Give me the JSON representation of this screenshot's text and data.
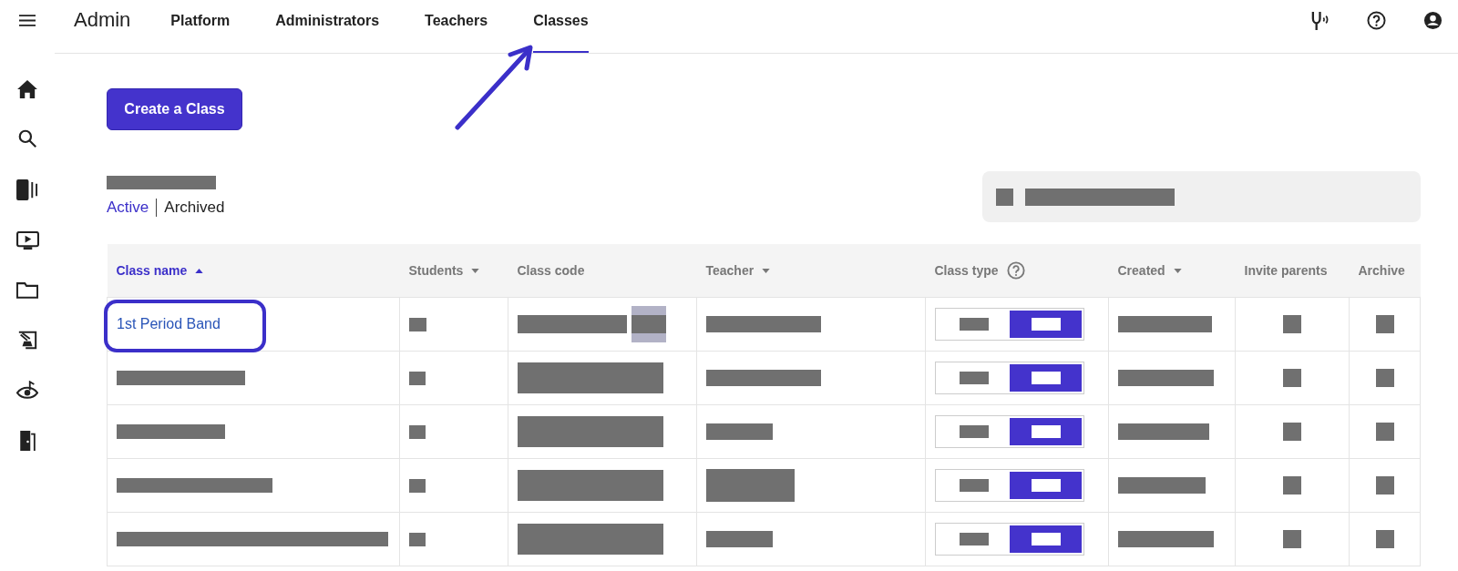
{
  "app_title": "Admin",
  "tabs": [
    {
      "label": "Platform",
      "selected": false
    },
    {
      "label": "Administrators",
      "selected": false
    },
    {
      "label": "Teachers",
      "selected": false
    },
    {
      "label": "Classes",
      "selected": true
    }
  ],
  "create_button": "Create a Class",
  "filters": [
    {
      "label": "Active",
      "selected": true
    },
    {
      "label": "Archived",
      "selected": false
    }
  ],
  "table": {
    "columns": [
      {
        "label": "Class name",
        "kind": "sort-up",
        "active": true,
        "help": false
      },
      {
        "label": "Students",
        "kind": "sort-down",
        "active": false,
        "help": false
      },
      {
        "label": "Class code",
        "kind": "plain",
        "active": false,
        "help": false
      },
      {
        "label": "Teacher",
        "kind": "sort-down",
        "active": false,
        "help": false
      },
      {
        "label": "Class type",
        "kind": "plain",
        "active": false,
        "help": true
      },
      {
        "label": "Created",
        "kind": "sort-down",
        "active": false,
        "help": false
      },
      {
        "label": "Invite parents",
        "kind": "plain",
        "active": false,
        "help": false
      },
      {
        "label": "Archive",
        "kind": "plain",
        "active": false,
        "help": false
      }
    ],
    "rows": [
      {
        "class_name": "1st Period Band",
        "highlighted": true,
        "class_type": [
          {
            "selected": false
          },
          {
            "selected": true
          }
        ]
      },
      {
        "highlighted": false,
        "class_type": [
          {
            "selected": false
          },
          {
            "selected": true
          }
        ]
      },
      {
        "highlighted": false,
        "class_type": [
          {
            "selected": false
          },
          {
            "selected": true
          }
        ]
      },
      {
        "highlighted": false,
        "class_type": [
          {
            "selected": false
          },
          {
            "selected": true
          }
        ]
      },
      {
        "highlighted": false,
        "class_type": [
          {
            "selected": false
          },
          {
            "selected": true
          }
        ]
      }
    ]
  }
}
